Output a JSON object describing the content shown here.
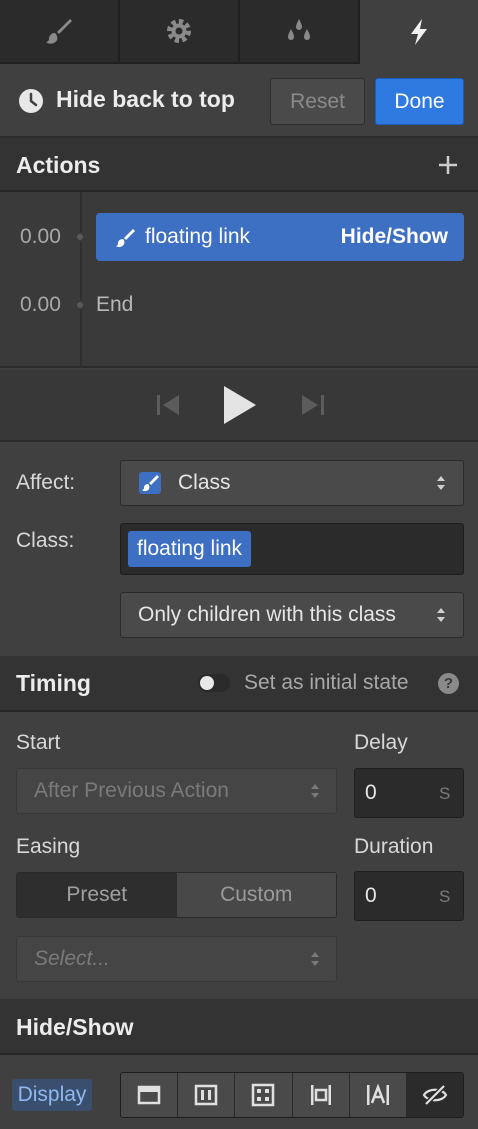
{
  "tabs": [
    {
      "icon": "brush-icon"
    },
    {
      "icon": "gear-icon"
    },
    {
      "icon": "drops-icon"
    },
    {
      "icon": "lightning-icon",
      "active": true
    }
  ],
  "header": {
    "title": "Hide back to top",
    "reset_label": "Reset",
    "done_label": "Done"
  },
  "actions": {
    "title": "Actions",
    "add_icon": "plus-icon",
    "rows": [
      {
        "time": "0.00",
        "name": "floating link",
        "type": "Hide/Show"
      },
      {
        "time": "0.00",
        "end_label": "End"
      }
    ]
  },
  "affect": {
    "label": "Affect:",
    "value": "Class",
    "class_label": "Class:",
    "class_tag": "floating link",
    "scope": "Only children with this class"
  },
  "timing": {
    "title": "Timing",
    "initial_state_label": "Set as initial state",
    "start_label": "Start",
    "start_value": "After Previous Action",
    "delay_label": "Delay",
    "delay_value": "0",
    "delay_unit": "S",
    "easing_label": "Easing",
    "preset_label": "Preset",
    "custom_label": "Custom",
    "duration_label": "Duration",
    "duration_value": "0",
    "duration_unit": "S",
    "ease_placeholder": "Select..."
  },
  "hideshow": {
    "title": "Hide/Show",
    "display_label": "Display",
    "display_options": [
      "block-icon",
      "flex-icon",
      "grid-icon",
      "inline-block-icon",
      "inline-icon",
      "none-icon"
    ],
    "selected": "none-icon"
  },
  "colors": {
    "accent": "#2f7ae0",
    "pill": "#3d6fc3",
    "panel": "#404040"
  }
}
